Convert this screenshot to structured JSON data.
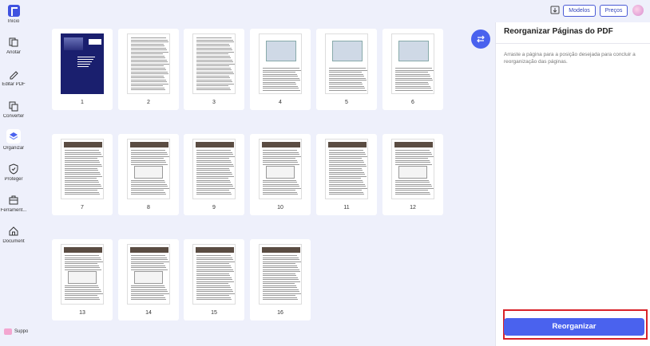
{
  "sidebar": {
    "items": [
      {
        "label": "Início",
        "icon": "home-icon"
      },
      {
        "label": "Anotar",
        "icon": "annotate-icon"
      },
      {
        "label": "Editar PDF",
        "icon": "edit-pen-icon"
      },
      {
        "label": "Converter",
        "icon": "convert-icon"
      },
      {
        "label": "Organizar",
        "icon": "organize-layers-icon",
        "active": true
      },
      {
        "label": "Proteger",
        "icon": "shield-icon"
      },
      {
        "label": "Ferrament...",
        "icon": "toolbox-icon"
      },
      {
        "label": "Document",
        "icon": "document-home-icon"
      }
    ],
    "support_label": "Support"
  },
  "header": {
    "models_label": "Modelos",
    "prices_label": "Preços"
  },
  "pages": [
    {
      "number": "1",
      "kind": "cover"
    },
    {
      "number": "2",
      "kind": "text"
    },
    {
      "number": "3",
      "kind": "text"
    },
    {
      "number": "4",
      "kind": "map"
    },
    {
      "number": "5",
      "kind": "map"
    },
    {
      "number": "6",
      "kind": "map"
    },
    {
      "number": "7",
      "kind": "header"
    },
    {
      "number": "8",
      "kind": "header-table"
    },
    {
      "number": "9",
      "kind": "header"
    },
    {
      "number": "10",
      "kind": "header-table"
    },
    {
      "number": "11",
      "kind": "header"
    },
    {
      "number": "12",
      "kind": "header-table"
    },
    {
      "number": "13",
      "kind": "header-table"
    },
    {
      "number": "14",
      "kind": "header-table"
    },
    {
      "number": "15",
      "kind": "header"
    },
    {
      "number": "16",
      "kind": "header"
    }
  ],
  "panel": {
    "title": "Reorganizar Páginas do PDF",
    "description": "Arraste a página para a posição desejada para concluir a reorganização das páginas.",
    "button_label": "Reorganizar"
  },
  "colors": {
    "accent": "#4a62ee",
    "highlight_border": "#d8232a",
    "background": "#eef0fb"
  }
}
